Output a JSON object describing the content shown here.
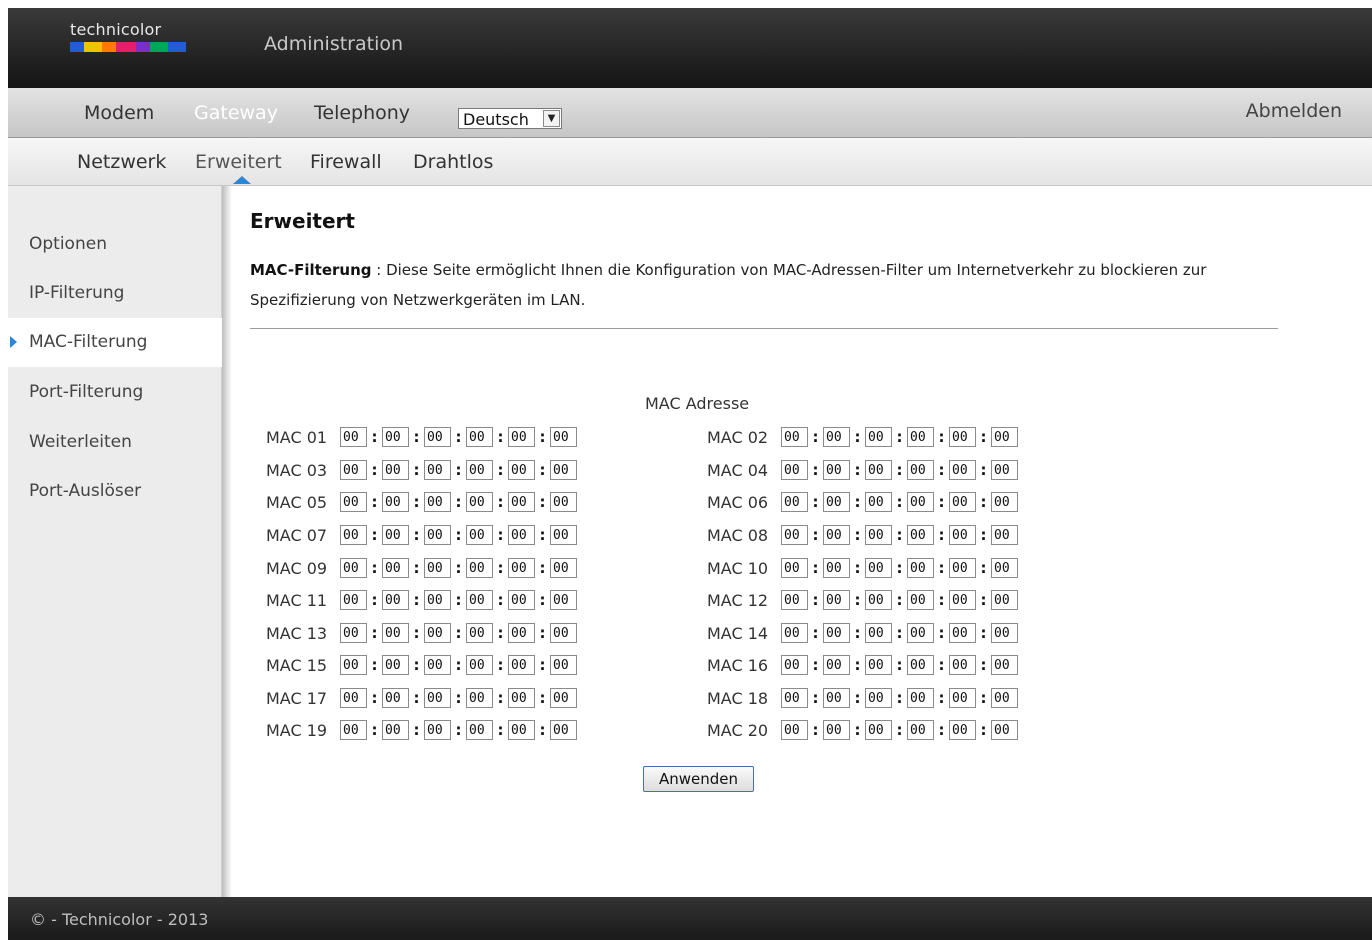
{
  "brand": {
    "logo_text": "technicolor",
    "logo_colors": [
      "#1f5fd0",
      "#f2c200",
      "#ff7a00",
      "#e0206a",
      "#7a2fc7",
      "#00a45a",
      "#1f5fd0"
    ]
  },
  "header": {
    "title": "Administration"
  },
  "main_nav": {
    "items": [
      {
        "label": "Modem",
        "active": false
      },
      {
        "label": "Gateway",
        "active": true
      },
      {
        "label": "Telephony",
        "active": false
      }
    ],
    "language": {
      "selected": "Deutsch"
    },
    "logout_label": "Abmelden"
  },
  "sub_nav": {
    "items": [
      {
        "label": "Netzwerk",
        "active": false
      },
      {
        "label": "Erweitert",
        "active": true
      },
      {
        "label": "Firewall",
        "active": false
      },
      {
        "label": "Drahtlos",
        "active": false
      }
    ]
  },
  "sidebar": {
    "items": [
      {
        "label": "Optionen",
        "active": false
      },
      {
        "label": "IP-Filterung",
        "active": false
      },
      {
        "label": "MAC-Filterung",
        "active": true
      },
      {
        "label": "Port-Filterung",
        "active": false
      },
      {
        "label": "Weiterleiten",
        "active": false
      },
      {
        "label": "Port-Auslöser",
        "active": false
      }
    ]
  },
  "content": {
    "title": "Erweitert",
    "desc_bold": "MAC-Filterung",
    "desc_sep": " : ",
    "desc_text": "Diese Seite ermöglicht Ihnen die Konfiguration von MAC-Adressen-Filter um Internetverkehr zu blockieren zur Spezifizierung von Netzwerkgeräten im LAN.",
    "mac_header": "MAC Adresse",
    "mac_entries": [
      {
        "label": "MAC 01",
        "octets": [
          "00",
          "00",
          "00",
          "00",
          "00",
          "00"
        ]
      },
      {
        "label": "MAC 02",
        "octets": [
          "00",
          "00",
          "00",
          "00",
          "00",
          "00"
        ]
      },
      {
        "label": "MAC 03",
        "octets": [
          "00",
          "00",
          "00",
          "00",
          "00",
          "00"
        ]
      },
      {
        "label": "MAC 04",
        "octets": [
          "00",
          "00",
          "00",
          "00",
          "00",
          "00"
        ]
      },
      {
        "label": "MAC 05",
        "octets": [
          "00",
          "00",
          "00",
          "00",
          "00",
          "00"
        ]
      },
      {
        "label": "MAC 06",
        "octets": [
          "00",
          "00",
          "00",
          "00",
          "00",
          "00"
        ]
      },
      {
        "label": "MAC 07",
        "octets": [
          "00",
          "00",
          "00",
          "00",
          "00",
          "00"
        ]
      },
      {
        "label": "MAC 08",
        "octets": [
          "00",
          "00",
          "00",
          "00",
          "00",
          "00"
        ]
      },
      {
        "label": "MAC 09",
        "octets": [
          "00",
          "00",
          "00",
          "00",
          "00",
          "00"
        ]
      },
      {
        "label": "MAC 10",
        "octets": [
          "00",
          "00",
          "00",
          "00",
          "00",
          "00"
        ]
      },
      {
        "label": "MAC 11",
        "octets": [
          "00",
          "00",
          "00",
          "00",
          "00",
          "00"
        ]
      },
      {
        "label": "MAC 12",
        "octets": [
          "00",
          "00",
          "00",
          "00",
          "00",
          "00"
        ]
      },
      {
        "label": "MAC 13",
        "octets": [
          "00",
          "00",
          "00",
          "00",
          "00",
          "00"
        ]
      },
      {
        "label": "MAC 14",
        "octets": [
          "00",
          "00",
          "00",
          "00",
          "00",
          "00"
        ]
      },
      {
        "label": "MAC 15",
        "octets": [
          "00",
          "00",
          "00",
          "00",
          "00",
          "00"
        ]
      },
      {
        "label": "MAC 16",
        "octets": [
          "00",
          "00",
          "00",
          "00",
          "00",
          "00"
        ]
      },
      {
        "label": "MAC 17",
        "octets": [
          "00",
          "00",
          "00",
          "00",
          "00",
          "00"
        ]
      },
      {
        "label": "MAC 18",
        "octets": [
          "00",
          "00",
          "00",
          "00",
          "00",
          "00"
        ]
      },
      {
        "label": "MAC 19",
        "octets": [
          "00",
          "00",
          "00",
          "00",
          "00",
          "00"
        ]
      },
      {
        "label": "MAC 20",
        "octets": [
          "00",
          "00",
          "00",
          "00",
          "00",
          "00"
        ]
      }
    ],
    "octet_separator": ":",
    "apply_label": "Anwenden"
  },
  "footer": {
    "text": "© - Technicolor - 2013"
  },
  "colors": {
    "accent": "#2a86d8"
  }
}
